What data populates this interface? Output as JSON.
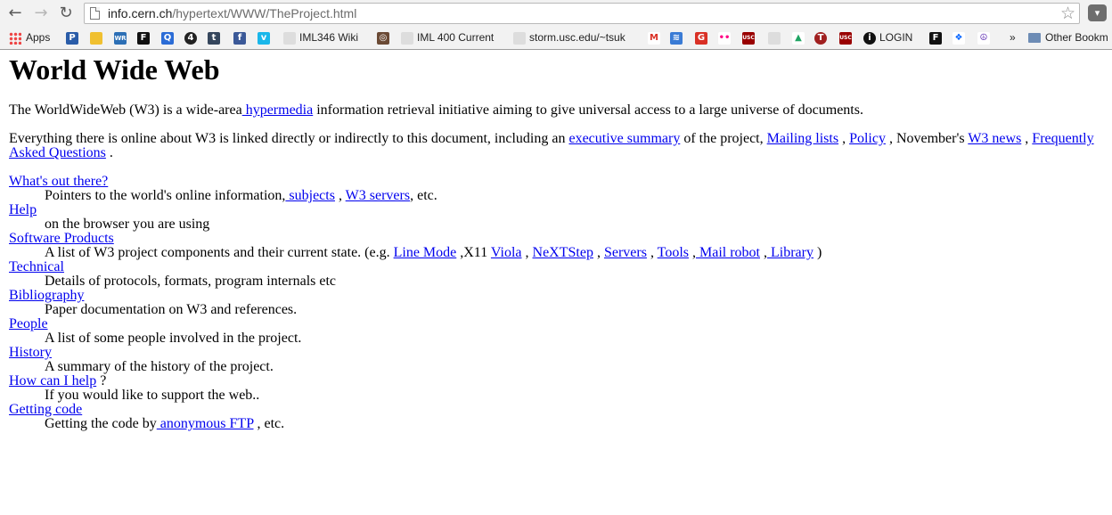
{
  "browser": {
    "url_host": "info.cern.ch",
    "url_path": "/hypertext/WWW/TheProject.html",
    "bookmarks": [
      {
        "label": "Apps",
        "icon": "apps-grid-icon"
      },
      {
        "label": "",
        "icon": "p-icon",
        "glyph": "P"
      },
      {
        "label": "",
        "icon": "sticky-icon",
        "glyph": ""
      },
      {
        "label": "",
        "icon": "wr-icon",
        "glyph": "WR"
      },
      {
        "label": "",
        "icon": "f-icon",
        "glyph": "F"
      },
      {
        "label": "",
        "icon": "q-icon",
        "glyph": "Q"
      },
      {
        "label": "",
        "icon": "four-icon",
        "glyph": "4"
      },
      {
        "label": "",
        "icon": "tumblr-icon",
        "glyph": "t"
      },
      {
        "label": "",
        "icon": "facebook-icon",
        "glyph": "f"
      },
      {
        "label": "",
        "icon": "vimeo-icon",
        "glyph": "v"
      },
      {
        "label": "IML346 Wiki",
        "icon": "apple-icon",
        "glyph": ""
      },
      {
        "label": "",
        "icon": "instagram-icon",
        "glyph": "◎"
      },
      {
        "label": "IML 400 Current",
        "icon": "apple-icon",
        "glyph": ""
      },
      {
        "label": "storm.usc.edu/~tsuk",
        "icon": "apple-icon",
        "glyph": ""
      },
      {
        "label": "",
        "icon": "gmail-icon",
        "glyph": "M"
      },
      {
        "label": "",
        "icon": "feed-icon",
        "glyph": "≋"
      },
      {
        "label": "",
        "icon": "red-g-icon",
        "glyph": "G"
      },
      {
        "label": "",
        "icon": "flickr-icon",
        "glyph": "••"
      },
      {
        "label": "",
        "icon": "usc-icon",
        "glyph": "USC"
      },
      {
        "label": "",
        "icon": "apple-icon",
        "glyph": ""
      },
      {
        "label": "",
        "icon": "drive-icon",
        "glyph": "▲"
      },
      {
        "label": "",
        "icon": "t-circle-icon",
        "glyph": "T"
      },
      {
        "label": "",
        "icon": "usc-icon",
        "glyph": "USC"
      },
      {
        "label": "LOGIN",
        "icon": "info-icon",
        "glyph": "i"
      },
      {
        "label": "",
        "icon": "f-icon",
        "glyph": "F"
      },
      {
        "label": "",
        "icon": "dropbox-icon",
        "glyph": "❖"
      },
      {
        "label": "",
        "icon": "peace-icon",
        "glyph": "☮"
      },
      {
        "label": "»",
        "icon": "",
        "glyph": ""
      },
      {
        "label": "Other Bookm",
        "icon": "folder-icon",
        "glyph": ""
      }
    ]
  },
  "page": {
    "title": "World Wide Web",
    "intro_before": "The WorldWideWeb (W3) is a wide-area",
    "intro_link": " hypermedia",
    "intro_after": " information retrieval initiative aiming to give universal access to a large universe of documents.",
    "p2_a": "Everything there is online about W3 is linked directly or indirectly to this document, including an ",
    "p2_link1": "executive summary",
    "p2_b": " of the project, ",
    "p2_link2": "Mailing lists",
    "p2_c": " , ",
    "p2_link3": "Policy",
    "p2_d": " , November's ",
    "p2_link4": "W3 news",
    "p2_e": " , ",
    "p2_link5": "Frequently Asked Questions",
    "p2_f": " .",
    "items": [
      {
        "term": "What's out there?",
        "desc_parts": [
          {
            "t": "Pointers to the world's online information,",
            "link": false
          },
          {
            "t": " subjects",
            "link": true
          },
          {
            "t": " , ",
            "link": false
          },
          {
            "t": "W3 servers",
            "link": true
          },
          {
            "t": ", etc.",
            "link": false
          }
        ]
      },
      {
        "term": "Help",
        "desc_parts": [
          {
            "t": "on the browser you are using",
            "link": false
          }
        ]
      },
      {
        "term": "Software Products",
        "desc_parts": [
          {
            "t": "A list of W3 project components and their current state. (e.g. ",
            "link": false
          },
          {
            "t": "Line Mode",
            "link": true
          },
          {
            "t": " ,X11 ",
            "link": false
          },
          {
            "t": "Viola",
            "link": true
          },
          {
            "t": " , ",
            "link": false
          },
          {
            "t": "NeXTStep",
            "link": true
          },
          {
            "t": " , ",
            "link": false
          },
          {
            "t": "Servers",
            "link": true
          },
          {
            "t": " , ",
            "link": false
          },
          {
            "t": "Tools",
            "link": true
          },
          {
            "t": " ,",
            "link": false
          },
          {
            "t": " Mail robot",
            "link": true
          },
          {
            "t": " ,",
            "link": false
          },
          {
            "t": " Library",
            "link": true
          },
          {
            "t": " )",
            "link": false
          }
        ]
      },
      {
        "term": "Technical",
        "desc_parts": [
          {
            "t": "Details of protocols, formats, program internals etc",
            "link": false
          }
        ]
      },
      {
        "term": "Bibliography",
        "desc_parts": [
          {
            "t": "Paper documentation on W3 and references.",
            "link": false
          }
        ]
      },
      {
        "term": "People",
        "desc_parts": [
          {
            "t": "A list of some people involved in the project.",
            "link": false
          }
        ]
      },
      {
        "term": "History",
        "desc_parts": [
          {
            "t": "A summary of the history of the project.",
            "link": false
          }
        ]
      },
      {
        "term": "How can I help",
        "term_suffix": " ?",
        "desc_parts": [
          {
            "t": "If you would like to support the web..",
            "link": false
          }
        ]
      },
      {
        "term": "Getting code",
        "desc_parts": [
          {
            "t": "Getting the code by",
            "link": false
          },
          {
            "t": " anonymous FTP",
            "link": true
          },
          {
            "t": " , etc.",
            "link": false
          }
        ]
      }
    ]
  },
  "colors": {
    "link": "#0000ee",
    "toolbar_bg": "#f2f2f2"
  }
}
